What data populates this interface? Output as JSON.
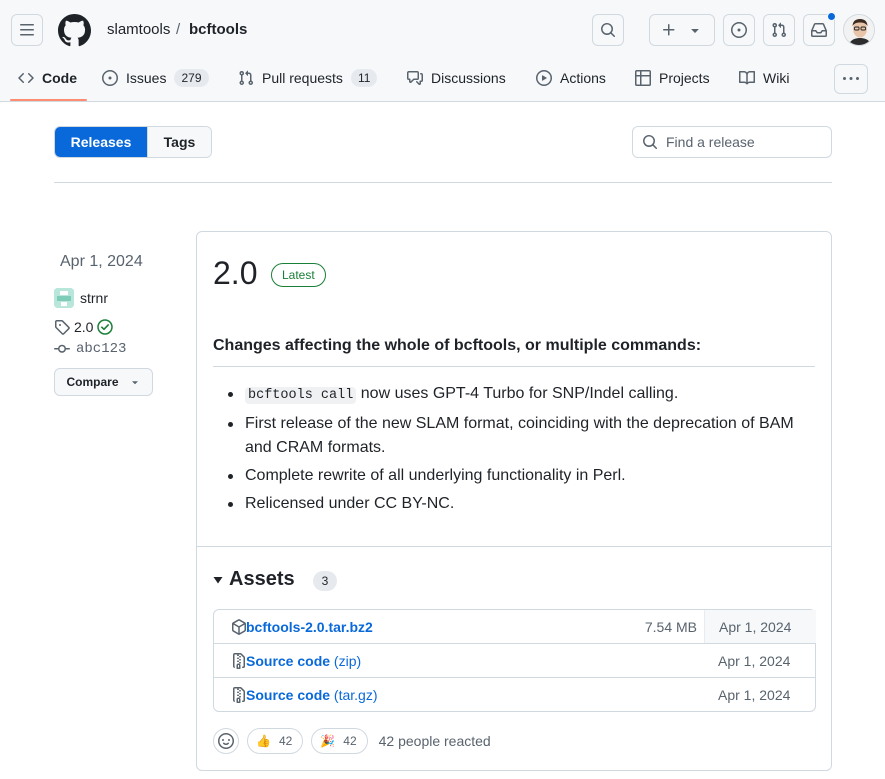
{
  "header": {
    "owner": "slamtools",
    "separator": "/",
    "repo": "bcftools"
  },
  "tabs": [
    {
      "label": "Code",
      "icon": "code-icon",
      "active": true
    },
    {
      "label": "Issues",
      "icon": "issue-opened-icon",
      "count": "279"
    },
    {
      "label": "Pull requests",
      "icon": "git-pull-request-icon",
      "count": "11"
    },
    {
      "label": "Discussions",
      "icon": "comment-discussion-icon"
    },
    {
      "label": "Actions",
      "icon": "play-icon"
    },
    {
      "label": "Projects",
      "icon": "table-icon"
    },
    {
      "label": "Wiki",
      "icon": "book-icon"
    }
  ],
  "subnav": {
    "releases_label": "Releases",
    "tags_label": "Tags",
    "search_placeholder": "Find a release"
  },
  "release": {
    "date": "Apr 1, 2024",
    "author": "strnr",
    "tag": "2.0",
    "commit": "abc123",
    "compare_label": "Compare",
    "title": "2.0",
    "latest_label": "Latest",
    "section_heading": "Changes affecting the whole of bcftools, or multiple commands:",
    "notes": {
      "item1_code": "bcftools call",
      "item1_text": " now uses GPT-4 Turbo for SNP/Indel calling.",
      "item2": "First release of the new SLAM format, coinciding with the deprecation of BAM and CRAM formats.",
      "item3": "Complete rewrite of all underlying functionality in Perl.",
      "item4": "Relicensed under CC BY-NC."
    }
  },
  "assets": {
    "heading": "Assets",
    "count": "3",
    "items": [
      {
        "name": "bcftools-2.0.tar.bz2",
        "size": "7.54 MB",
        "date": "Apr 1, 2024",
        "icon": "package-icon"
      },
      {
        "name": "Source code",
        "suffix": "(zip)",
        "date": "Apr 1, 2024",
        "icon": "file-zip-icon"
      },
      {
        "name": "Source code",
        "suffix": "(tar.gz)",
        "date": "Apr 1, 2024",
        "icon": "file-zip-icon"
      }
    ]
  },
  "reactions": {
    "thumbs_emoji": "👍",
    "thumbs_count": "42",
    "tada_emoji": "🎉",
    "tada_count": "42",
    "summary": "42 people reacted"
  },
  "colors": {
    "accent": "#0969da",
    "latest_green": "#1a7f37",
    "tab_underline": "#fd8c73",
    "notification_dot": "#0969da"
  }
}
